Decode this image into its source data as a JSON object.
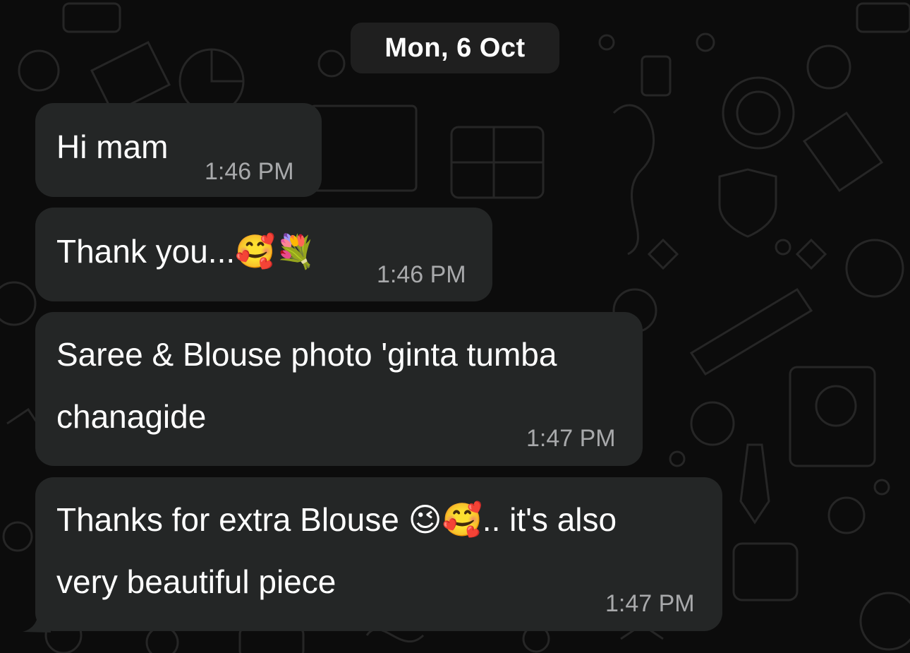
{
  "date_chip": "Mon, 6 Oct",
  "messages": [
    {
      "text": "Hi mam",
      "time": "1:46 PM"
    },
    {
      "text": "Thank you...🥰💐",
      "time": "1:46 PM"
    },
    {
      "text_line1": "Saree & Blouse photo 'ginta tumba",
      "text_line2": "chanagide",
      "time": "1:47 PM"
    },
    {
      "text_line1": "Thanks for extra Blouse 😉🥰.. it's also",
      "text_line2": "very beautiful piece",
      "time": "1:47 PM"
    }
  ],
  "colors": {
    "background": "#0c0c0c",
    "bubble": "#242626",
    "date_chip": "#1f1f1f",
    "text": "#ffffff",
    "timestamp": "#a8a9ab"
  }
}
